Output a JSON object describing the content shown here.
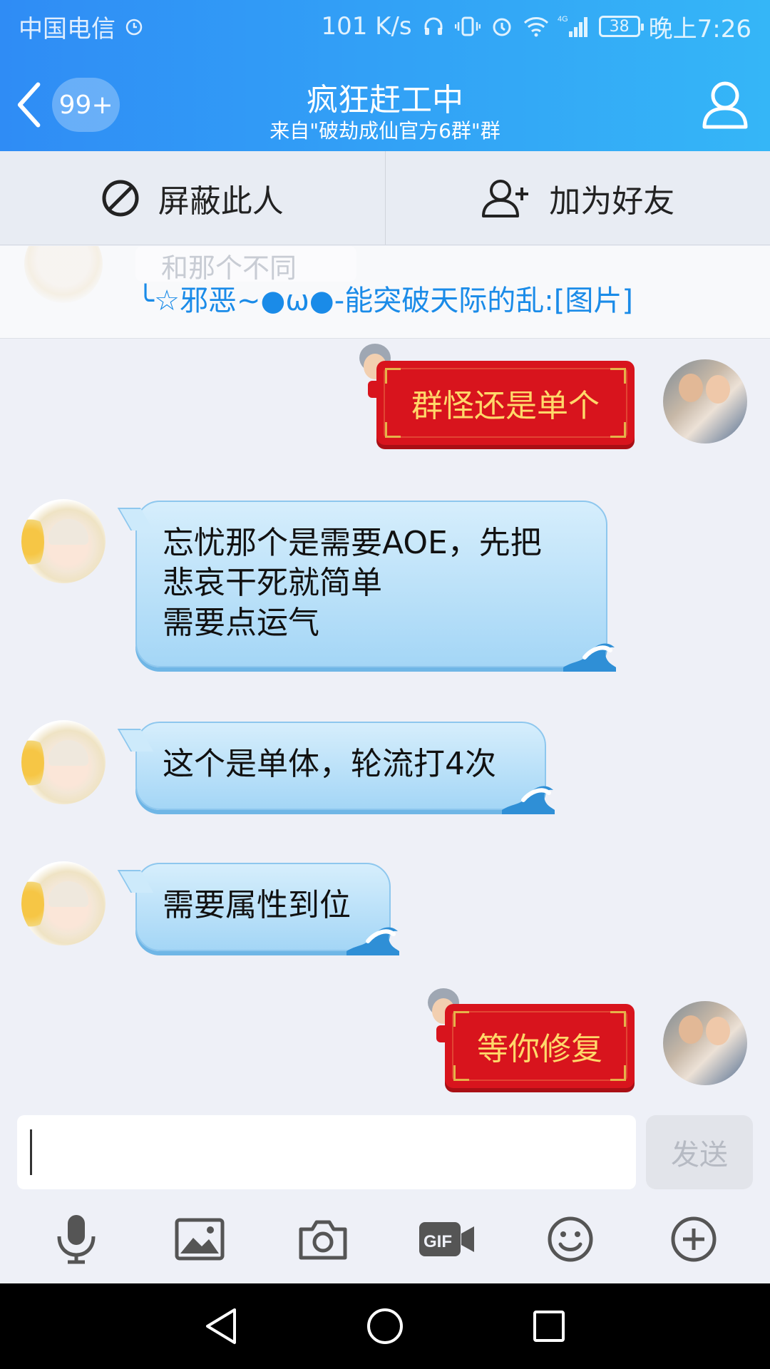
{
  "status_bar": {
    "carrier": "中国电信",
    "network_speed": "101 K/s",
    "network_type": "4G",
    "battery": "38",
    "time": "晚上7:26"
  },
  "title_bar": {
    "unread_count": "99+",
    "title": "疯狂赶工中",
    "subtitle": "来自\"破劫成仙官方6群\"群"
  },
  "actions": {
    "block_label": "屏蔽此人",
    "add_friend_label": "加为好友"
  },
  "notice": {
    "ghost_text": "和那个不同",
    "text": "╰☆邪恶~●ω●-能突破天际的乱:[图片]"
  },
  "messages": [
    {
      "side": "right",
      "style": "red",
      "text": "群怪还是单个"
    },
    {
      "side": "left",
      "style": "blue",
      "lines": [
        "忘忧那个是需要AOE，先把",
        "悲哀干死就简单",
        "需要点运气"
      ]
    },
    {
      "side": "left",
      "style": "blue",
      "lines": [
        "这个是单体，轮流打4次"
      ]
    },
    {
      "side": "left",
      "style": "blue",
      "lines": [
        "需要属性到位"
      ]
    },
    {
      "side": "right",
      "style": "red",
      "text": "等你修复"
    }
  ],
  "composer": {
    "input_value": "",
    "send_label": "发送"
  },
  "toolbar": {
    "items": [
      "microphone-icon",
      "image-icon",
      "camera-icon",
      "gif-icon",
      "emoji-icon",
      "plus-icon"
    ]
  },
  "colors": {
    "header_start": "#2f8cf5",
    "header_end": "#35b6f7",
    "red_bubble": "#d8141d",
    "red_bubble_text": "#ffd86a",
    "notice_link": "#1a8be8"
  }
}
